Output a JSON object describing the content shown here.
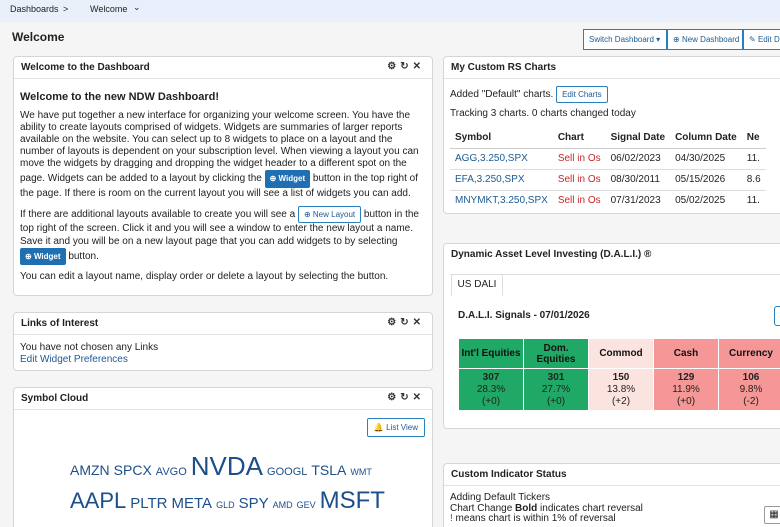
{
  "breadcrumb": {
    "root": "Dashboards",
    "sep": ">",
    "current": "Welcome",
    "caret": "⌄"
  },
  "page_title": "Welcome",
  "toolbar": {
    "switch": "Switch Dashboard",
    "new": "New Dashboard",
    "edit": "Edit D"
  },
  "welcome": {
    "title": "Welcome to the Dashboard",
    "heading": "Welcome to the new NDW Dashboard!",
    "p1a": "We have put together a new interface for organizing your welcome screen. You have the ability to create layouts comprised of widgets. Widgets are summaries of larger reports available on the website. You can select up to 8 widgets to place on a layout and the number of layouts is dependent on your subscription level. When viewing a layout you can move the widgets by dragging and dropping the widget header to a different spot on the page. Widgets can be added to a layout by clicking the",
    "p1_btn": "Widget",
    "p1b": "button in the top right of the page. If there is room on the current layout you will see a list of widgets you can add.",
    "p2a": "If there are additional layouts available to create you will see a",
    "p2_btn": "New Layout",
    "p2b": "button in the top right of the screen. Click it and you will see a window to enter the new layout a name. Save it and you will be on a new layout page that you can add widgets to by selecting",
    "p2_btn2": "Widget",
    "p2c": "button.",
    "p3": "You can edit a layout name, display order or delete a layout by selecting the button."
  },
  "links": {
    "title": "Links of Interest",
    "text": "You have not chosen any Links",
    "link": "Edit Widget Preferences"
  },
  "cloud": {
    "title": "Symbol Cloud",
    "list_btn": "List View",
    "row1": [
      {
        "t": "AMZN",
        "s": 14
      },
      {
        "t": "SPCX",
        "s": 14
      },
      {
        "t": "AVGO",
        "s": 11
      },
      {
        "t": "NVDA",
        "s": 26
      },
      {
        "t": "GOOGL",
        "s": 11
      },
      {
        "t": "TSLA",
        "s": 14
      },
      {
        "t": "WMT",
        "s": 9
      }
    ],
    "row2": [
      {
        "t": "AAPL",
        "s": 22
      },
      {
        "t": "PLTR",
        "s": 15
      },
      {
        "t": "META",
        "s": 15
      },
      {
        "t": "GLD",
        "s": 9
      },
      {
        "t": "SPY",
        "s": 15
      },
      {
        "t": "AMD",
        "s": 9
      },
      {
        "t": "GEV",
        "s": 9
      },
      {
        "t": "MSFT",
        "s": 24
      }
    ]
  },
  "rs": {
    "title": "My Custom RS Charts",
    "added": "Added \"Default\" charts.",
    "edit_btn": "Edit Charts",
    "tracking": "Tracking 3 charts.  0 charts changed today",
    "headers": [
      "Symbol",
      "Chart",
      "Signal Date",
      "Column Date",
      "Ne"
    ],
    "rows": [
      [
        "AGG,3.250,SPX",
        "Sell in Os",
        "06/02/2023",
        "04/30/2025",
        "11."
      ],
      [
        "EFA,3.250,SPX",
        "Sell in Os",
        "08/30/2011",
        "05/15/2026",
        "8.6"
      ],
      [
        "MNYMKT,3.250,SPX",
        "Sell in Os",
        "07/31/2023",
        "05/02/2025",
        "11."
      ]
    ]
  },
  "dali": {
    "title": "Dynamic Asset Level Investing (D.A.L.I.) ®",
    "tab": "US DALI",
    "signals": "D.A.L.I. Signals - 07/01/2026",
    "cols": [
      {
        "name": "Int'l Equities",
        "score": "307",
        "pct": "28.3%",
        "chg": "(+0)",
        "color": "#1fa866",
        "text": "#111"
      },
      {
        "name": "Dom. Equities",
        "score": "301",
        "pct": "27.7%",
        "chg": "(+0)",
        "color": "#1fa866",
        "text": "#111"
      },
      {
        "name": "Commod",
        "score": "150",
        "pct": "13.8%",
        "chg": "(+2)",
        "color": "#fbe4df",
        "text": "#111"
      },
      {
        "name": "Cash",
        "score": "129",
        "pct": "11.9%",
        "chg": "(+0)",
        "color": "#f49796",
        "text": "#111"
      },
      {
        "name": "Currency",
        "score": "106",
        "pct": "9.8%",
        "chg": "(-2)",
        "color": "#f49796",
        "text": "#111"
      }
    ]
  },
  "custom": {
    "title": "Custom Indicator Status",
    "l1": "Adding Default Tickers",
    "l2a": "Chart Change ",
    "l2b": "Bold",
    "l2c": " indicates chart reversal",
    "l3a": "!",
    "l3b": " means chart is within 1% of reversal"
  }
}
